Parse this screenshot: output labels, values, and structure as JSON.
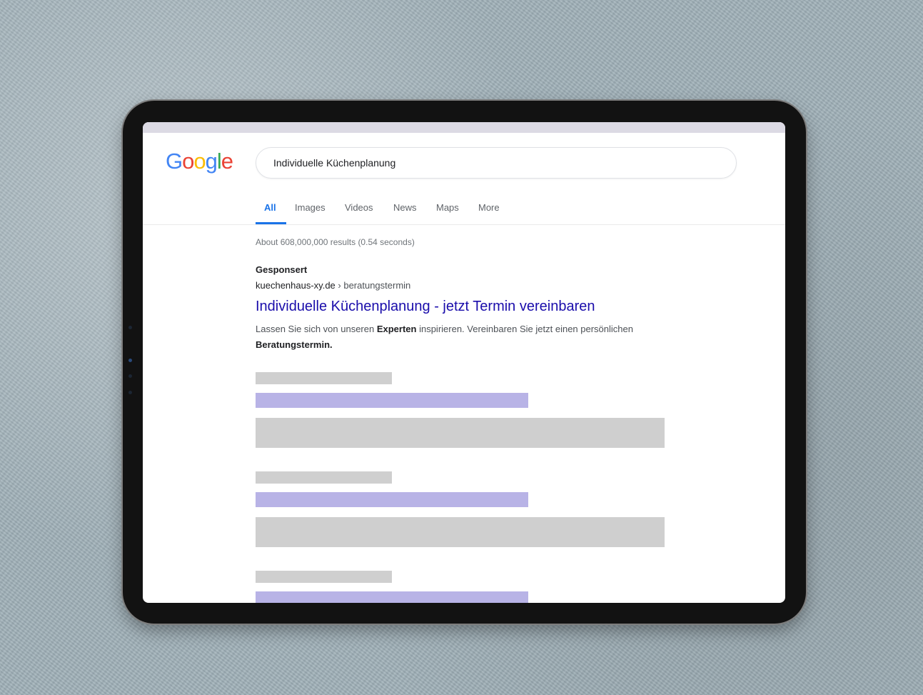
{
  "google_logo": {
    "letters": [
      "G",
      "o",
      "o",
      "g",
      "l",
      "e"
    ],
    "colors": [
      "#4285F4",
      "#EA4335",
      "#FBBC05",
      "#4285F4",
      "#34A853",
      "#EA4335"
    ]
  },
  "search": {
    "query": "Individuelle Küchenplanung"
  },
  "tabs": [
    {
      "label": "All",
      "active": true
    },
    {
      "label": "Images",
      "active": false
    },
    {
      "label": "Videos",
      "active": false
    },
    {
      "label": "News",
      "active": false
    },
    {
      "label": "Maps",
      "active": false
    },
    {
      "label": "More",
      "active": false
    }
  ],
  "results_stats": "About 608,000,000 results (0.54 seconds)",
  "ad": {
    "label": "Gesponsert",
    "domain": "kuechenhaus-xy.de",
    "separator": " › ",
    "path": "beratungstermin",
    "title": "Individuelle Küchenplanung - jetzt Termin vereinbaren",
    "desc_part1": "Lassen Sie sich von unseren ",
    "desc_bold1": "Experten",
    "desc_part2": " inspirieren. Vereinbaren Sie jetzt einen persönlichen ",
    "desc_bold2": "Beratungstermin."
  },
  "colors": {
    "link_title": "#1a0dab",
    "active_tab": "#1a73e8",
    "placeholder_gray": "#cfcfcf",
    "placeholder_purple": "#b8b3e6"
  }
}
